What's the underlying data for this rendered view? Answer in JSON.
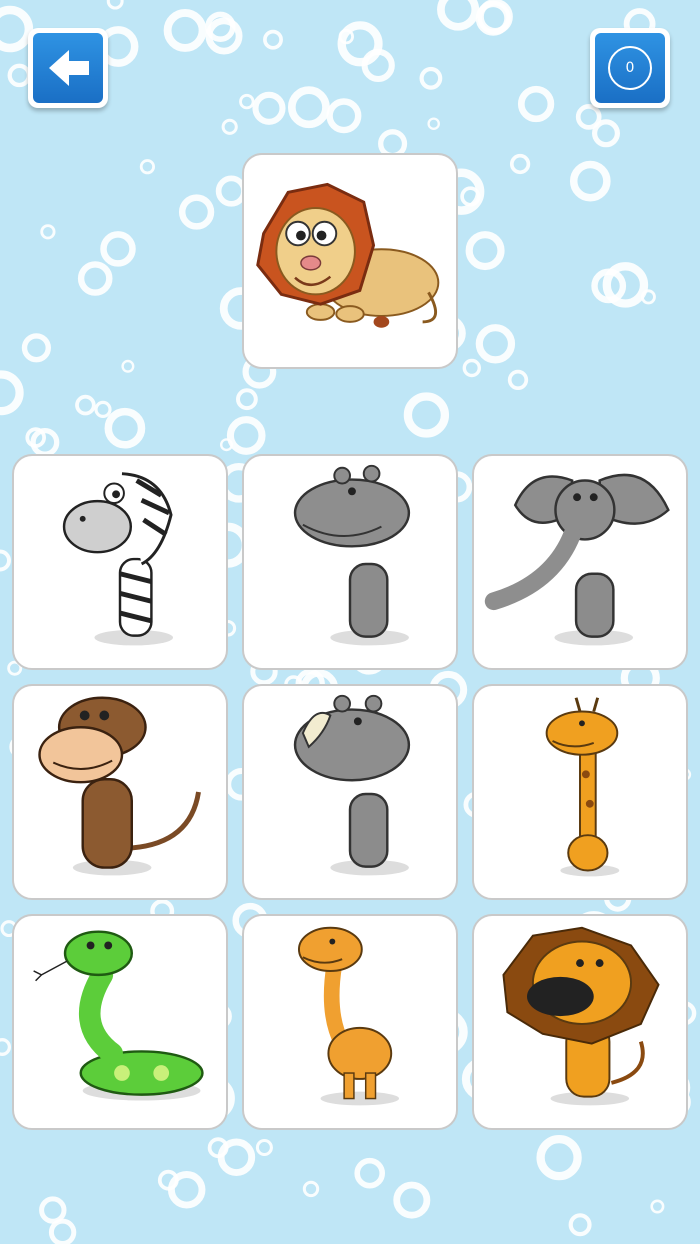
{
  "header": {
    "back_icon": "arrow-left-icon",
    "score_value": "0",
    "accent_color": "#2484d6"
  },
  "target": {
    "animal": "lion",
    "colored": true
  },
  "options": [
    {
      "animal": "zebra",
      "colored": false
    },
    {
      "animal": "hippo",
      "colored": false
    },
    {
      "animal": "elephant",
      "colored": false
    },
    {
      "animal": "monkey",
      "colored": true
    },
    {
      "animal": "rhino",
      "colored": false
    },
    {
      "animal": "giraffe",
      "colored": true
    },
    {
      "animal": "snake",
      "colored": true
    },
    {
      "animal": "camel",
      "colored": true
    },
    {
      "animal": "lion",
      "colored": true
    }
  ],
  "colors": {
    "background": "#bfe6f6",
    "bubble": "#ffffff",
    "card_border": "#c9c9c9",
    "button": "#2484d6"
  }
}
